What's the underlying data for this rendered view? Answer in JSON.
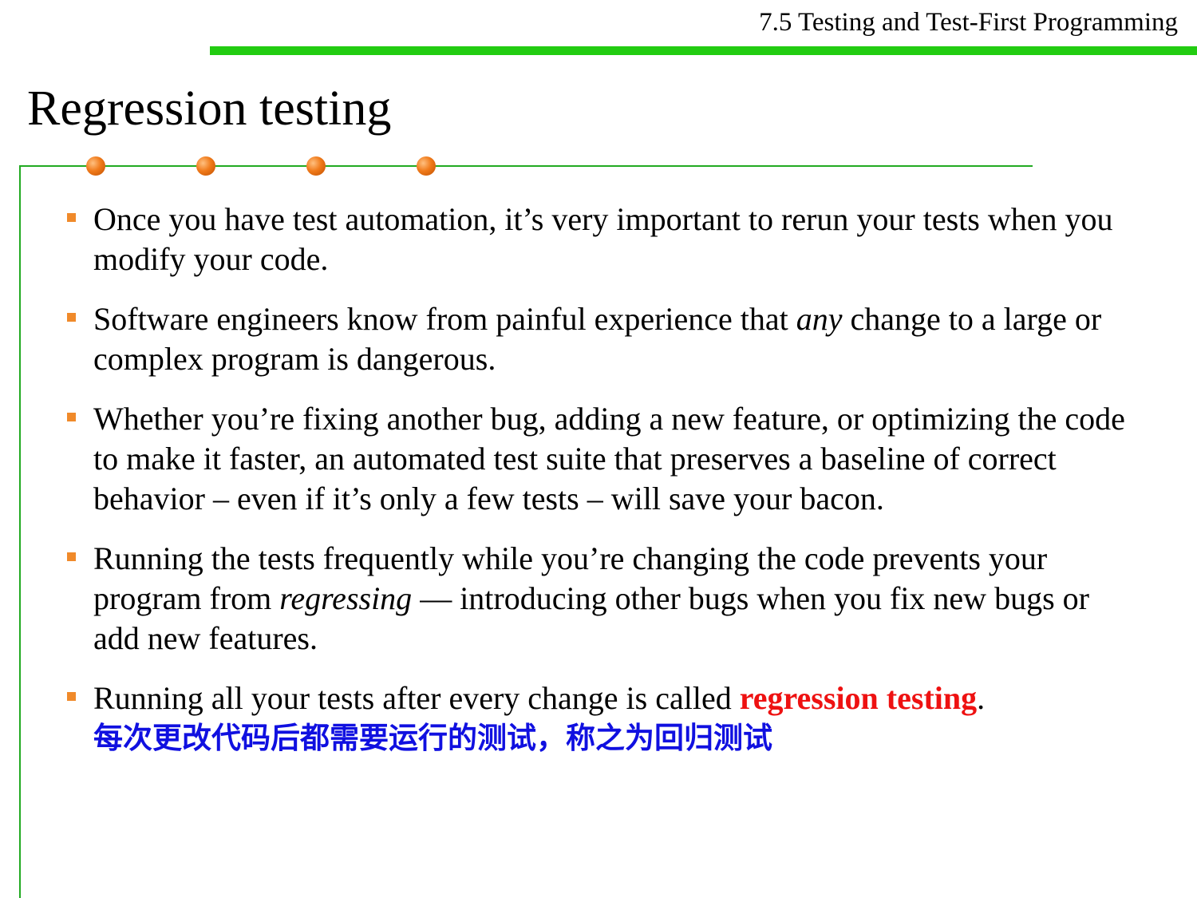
{
  "header": {
    "section_title": "7.5 Testing and Test-First Programming",
    "accent_color": "#22cc11"
  },
  "slide": {
    "title": "Regression testing"
  },
  "bullets": [
    {
      "text": "Once you have test automation, it’s very important to rerun your tests when you modify your code."
    },
    {
      "before": "Software engineers know from painful experience that ",
      "italic": "any",
      "after": " change to a large or complex program is dangerous."
    },
    {
      "text": "Whether you’re fixing another bug, adding a new feature, or optimizing the code to make it faster, an automated test suite that preserves a baseline of correct behavior – even if it’s only a few tests – will save your bacon."
    },
    {
      "before": "Running the tests frequently while you’re changing the code prevents your program from ",
      "italic": "regressing",
      "after": " — introducing other bugs when you fix new bugs or add new features."
    },
    {
      "before": "Running all your tests after every change is called ",
      "highlight": "regression testing",
      "after": ".",
      "chinese": "每次更改代码后都需要运行的测试，称之为回归测试"
    }
  ],
  "colors": {
    "bullet_marker": "#f08a2a",
    "highlight_red": "#ee1111",
    "chinese_blue": "#1010e0",
    "rule_green": "#22aa22",
    "dot_orange": "#f07a1a"
  }
}
